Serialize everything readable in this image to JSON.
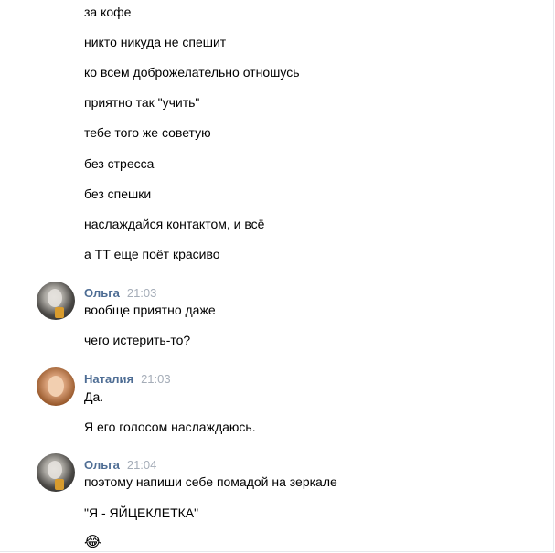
{
  "messages_top": [
    "за кофе",
    "никто никуда не спешит",
    "ко всем доброжелательно отношусь",
    "приятно так \"учить\"",
    "тебе того же советую",
    "без стресса",
    "без спешки",
    "наслаждайся контактом, и всё",
    "а ТТ еще поёт красиво"
  ],
  "groups": [
    {
      "author": "Ольга",
      "time": "21:03",
      "messages": [
        "вообще приятно даже",
        "чего истерить-то?"
      ]
    },
    {
      "author": "Наталия",
      "time": "21:03",
      "messages": [
        "Да.",
        "Я его голосом наслаждаюсь."
      ]
    },
    {
      "author": "Ольга",
      "time": "21:04",
      "messages": [
        "поэтому напиши себе помадой на зеркале",
        "\"Я - ЯЙЦЕКЛЕТКА\"",
        "😂"
      ]
    }
  ],
  "icons": {
    "avatar_olga": "avatar-olga-icon",
    "avatar_natalia": "avatar-natalia-icon"
  },
  "colors": {
    "author": "#4e6d94",
    "time": "#a5adb8",
    "text": "#000000"
  }
}
